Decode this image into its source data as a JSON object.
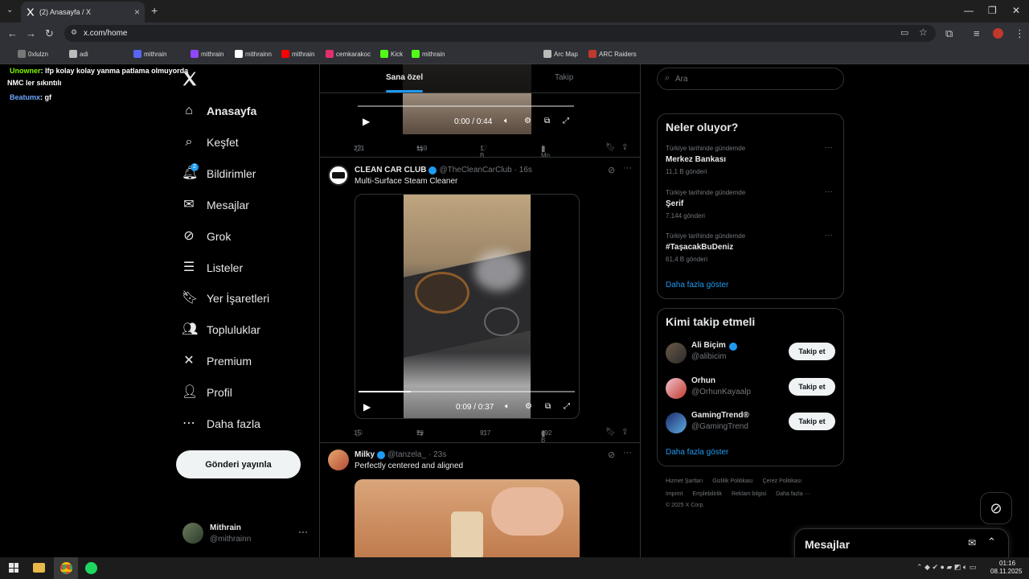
{
  "browser": {
    "tab_title": "(2) Anasayfa / X",
    "url": "x.com/home",
    "bookmarks": [
      "0xlulzn",
      "adi",
      "mithrain",
      "mithrain",
      "mithrainn",
      "mithrain",
      "cemkarakoc",
      "Kick",
      "mithrain",
      "Arc Map",
      "ARC Raiders"
    ]
  },
  "overlay_chat": [
    {
      "user": "Unowner",
      "text": ": lfp kolay kolay yanma patlama olmuyorda"
    },
    {
      "user": "",
      "text": "NMC ler sıkıntılı"
    },
    {
      "user": "Beatumx",
      "text": ": gf"
    }
  ],
  "nav": {
    "items": [
      "Anasayfa",
      "Keşfet",
      "Bildirimler",
      "Mesajlar",
      "Grok",
      "Listeler",
      "Yer İşaretleri",
      "Topluluklar",
      "Premium",
      "Profil",
      "Daha fazla"
    ],
    "notif_badge": "2",
    "post_button": "Gönderi yayınla",
    "account_name": "Mithrain",
    "account_handle": "@mithrainn"
  },
  "timeline": {
    "tabs": [
      "Sana özel",
      "Takip"
    ],
    "post0": {
      "time": "0:00 / 0:44",
      "replies": "221",
      "reposts": "159",
      "likes": "1 B",
      "views": "1 Mn",
      "progress": 0.0
    },
    "post1": {
      "name": "CLEAN CAR CLUB",
      "handle": "@TheCleanCarClub",
      "age": "· 16s",
      "text": "Multi-Surface Steam Cleaner",
      "time": "0:09 / 0:37",
      "replies": "15",
      "reposts": "79",
      "likes": "917",
      "views": "492 B",
      "progress": 0.24
    },
    "post2": {
      "name": "Milky",
      "handle": "@tanzela_",
      "age": "· 23s",
      "text": "Perfectly centered and aligned"
    }
  },
  "right": {
    "search_placeholder": "Ara",
    "trends_title": "Neler oluyor?",
    "trends": [
      {
        "meta": "Türkiye tarihinde gündemde",
        "title": "Merkez Bankası",
        "count": "11,1 B gönderi"
      },
      {
        "meta": "Türkiye tarihinde gündemde",
        "title": "Şerif",
        "count": "7.144 gönderi"
      },
      {
        "meta": "Türkiye tarihinde gündemde",
        "title": "#TaşacakBuDeniz",
        "count": "61,4 B gönderi"
      }
    ],
    "trends_more": "Daha fazla göster",
    "wtf_title": "Kimi takip etmeli",
    "who_to_follow": [
      {
        "name": "Ali Biçim",
        "handle": "@alibicim",
        "button": "Takip et"
      },
      {
        "name": "Orhun",
        "handle": "@OrhunKayaalp",
        "button": "Takip et"
      },
      {
        "name": "GamingTrend®",
        "handle": "@GamingTrend",
        "button": "Takip et"
      }
    ],
    "wtf_more": "Daha fazla göster",
    "footer_line1": [
      "Hizmet Şartları",
      "Gizlilik Politikası",
      "Çerez Politikası"
    ],
    "footer_line2": [
      "Imprint",
      "Erişilebilirlik",
      "Reklam bilgisi",
      "Daha fazla ···"
    ],
    "copyright": "© 2025 X Corp.",
    "messages_drawer": "Mesajlar"
  },
  "taskbar": {
    "time": "01:16",
    "date": "08.11.2025"
  }
}
